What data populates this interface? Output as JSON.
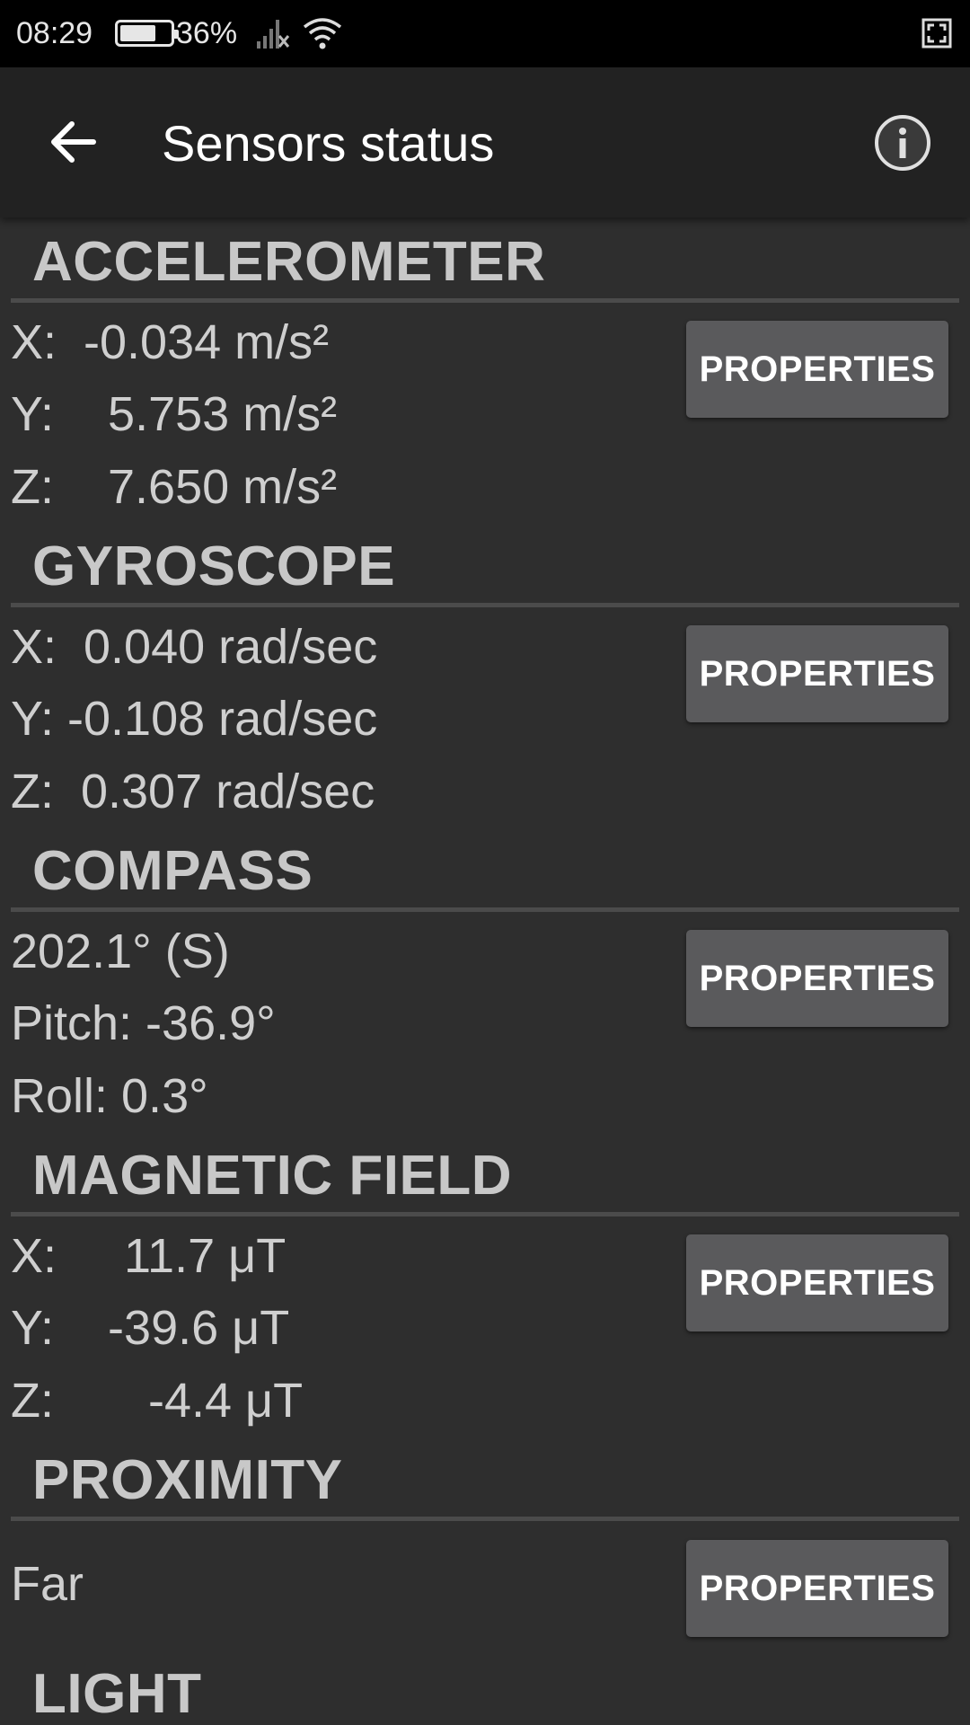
{
  "status_bar": {
    "time": "08:29",
    "battery_percent": "36%",
    "battery_level": 0.72,
    "icons": [
      "battery-icon",
      "signal-icon",
      "wifi-icon",
      "fullscreen-icon"
    ]
  },
  "app_bar": {
    "title": "Sensors status",
    "back_icon": "arrow-left-icon",
    "info_icon": "info-icon"
  },
  "colors": {
    "background": "#2e2e2e",
    "app_bar": "#222222",
    "button": "#5a5a5c",
    "heading": "#c8c8c8",
    "text": "#cfcfcf"
  },
  "sections": [
    {
      "title": "ACCELEROMETER",
      "readings": [
        "X:  -0.034 m/s²",
        "Y:    5.753 m/s²",
        "Z:    7.650 m/s²"
      ],
      "button": "PROPERTIES"
    },
    {
      "title": "GYROSCOPE",
      "readings": [
        "X:  0.040 rad/sec",
        "Y: -0.108 rad/sec",
        "Z:  0.307 rad/sec"
      ],
      "button": "PROPERTIES"
    },
    {
      "title": "COMPASS",
      "readings": [
        "202.1° (S)",
        "Pitch: -36.9°",
        "Roll: 0.3°"
      ],
      "button": "PROPERTIES"
    },
    {
      "title": "MAGNETIC FIELD",
      "readings": [
        "X:     11.7 μT",
        "Y:    -39.6 μT",
        "Z:       -4.4 μT"
      ],
      "button": "PROPERTIES"
    },
    {
      "title": "PROXIMITY",
      "readings": [
        "Far"
      ],
      "button": "PROPERTIES"
    },
    {
      "title": "LIGHT",
      "readings": [],
      "button": ""
    }
  ]
}
